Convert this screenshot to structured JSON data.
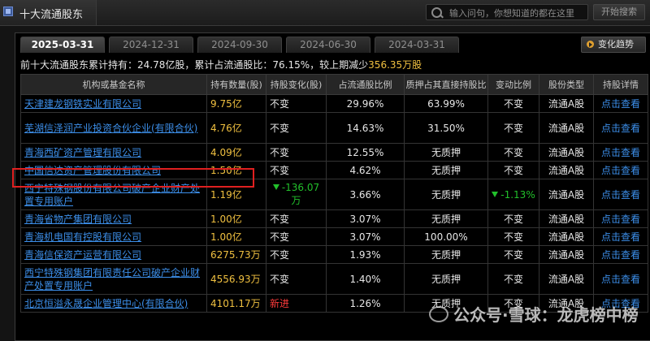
{
  "window": {
    "title": "十大流通股东"
  },
  "search": {
    "placeholder": "输入问句，你想知道的都在这里",
    "button": "开始搜索"
  },
  "tabs": [
    "2025-03-31",
    "2024-12-31",
    "2024-09-30",
    "2024-06-30",
    "2024-03-31"
  ],
  "active_tab": 0,
  "change_button": "变化趋势",
  "summary": {
    "prefix": "前十大流通股东累计持有：",
    "total": "24.78亿股",
    "ratio_label": "，累计占流通股比：",
    "ratio": "76.15%",
    "change_label": "，较上期减少",
    "change": "356.35万股"
  },
  "table": {
    "headers": [
      "机构或基金名称",
      "持有数量(股)",
      "持股变化(股)",
      "占流通股比例",
      "质押占其直接持股比",
      "变动比例",
      "股份类型",
      "持股详情"
    ],
    "rows": [
      {
        "name": "天津建龙钢铁实业有限公司",
        "hold": "9.75亿",
        "change": "不变",
        "change_type": "none",
        "ratio": "29.96%",
        "pledge": "63.99%",
        "chg_ratio": "不变",
        "chg_ratio_type": "none",
        "type": "流通A股",
        "detail": "点击查看",
        "tall": false
      },
      {
        "name": "芜湖信泽润产业投资合伙企业(有限合伙)",
        "hold": "4.76亿",
        "change": "不变",
        "change_type": "none",
        "ratio": "14.63%",
        "pledge": "31.50%",
        "chg_ratio": "不变",
        "chg_ratio_type": "none",
        "type": "流通A股",
        "detail": "点击查看",
        "tall": true
      },
      {
        "name": "青海西矿资产管理有限公司",
        "hold": "4.09亿",
        "change": "不变",
        "change_type": "none",
        "ratio": "12.55%",
        "pledge": "无质押",
        "chg_ratio": "不变",
        "chg_ratio_type": "none",
        "type": "流通A股",
        "detail": "点击查看",
        "tall": false
      },
      {
        "name": "中国信达资产管理股份有限公司",
        "hold": "1.50亿",
        "change": "不变",
        "change_type": "none",
        "ratio": "4.62%",
        "pledge": "无质押",
        "chg_ratio": "不变",
        "chg_ratio_type": "none",
        "type": "流通A股",
        "detail": "点击查看",
        "tall": false
      },
      {
        "name": "西宁特殊钢股份有限公司破产企业财产处置专用账户",
        "hold": "1.19亿",
        "change": "-136.07万",
        "change_type": "down",
        "ratio": "3.66%",
        "pledge": "无质押",
        "chg_ratio": "-1.13%",
        "chg_ratio_type": "down",
        "type": "流通A股",
        "detail": "点击查看",
        "tall": true
      },
      {
        "name": "青海省物产集团有限公司",
        "hold": "1.00亿",
        "change": "不变",
        "change_type": "none",
        "ratio": "3.07%",
        "pledge": "无质押",
        "chg_ratio": "不变",
        "chg_ratio_type": "none",
        "type": "流通A股",
        "detail": "点击查看",
        "tall": false
      },
      {
        "name": "青海机电国有控股有限公司",
        "hold": "1.00亿",
        "change": "不变",
        "change_type": "none",
        "ratio": "3.07%",
        "pledge": "100.00%",
        "chg_ratio": "不变",
        "chg_ratio_type": "none",
        "type": "流通A股",
        "detail": "点击查看",
        "tall": false
      },
      {
        "name": "青海信保资产运营有限公司",
        "hold": "6275.73万",
        "change": "不变",
        "change_type": "none",
        "ratio": "1.93%",
        "pledge": "无质押",
        "chg_ratio": "不变",
        "chg_ratio_type": "none",
        "type": "流通A股",
        "detail": "点击查看",
        "tall": false
      },
      {
        "name": "西宁特殊钢集团有限责任公司破产企业财产处置专用账户",
        "hold": "4556.93万",
        "change": "不变",
        "change_type": "none",
        "ratio": "1.40%",
        "pledge": "无质押",
        "chg_ratio": "不变",
        "chg_ratio_type": "none",
        "type": "流通A股",
        "detail": "点击查看",
        "tall": true
      },
      {
        "name": "北京恒溢永晟企业管理中心(有限合伙)",
        "hold": "4101.17万",
        "change": "新进",
        "change_type": "new",
        "ratio": "1.26%",
        "pledge": "无质押",
        "chg_ratio": "不变",
        "chg_ratio_type": "none",
        "type": "流通A股",
        "detail": "点击查看",
        "tall": false
      }
    ]
  },
  "watermark": "公众号·雪球：龙虎榜中榜",
  "colors": {
    "holding": "#f0c040",
    "link": "#3c8ee8",
    "down": "#22c02b",
    "new": "#ff3b3b",
    "highlight": "#e02020"
  }
}
